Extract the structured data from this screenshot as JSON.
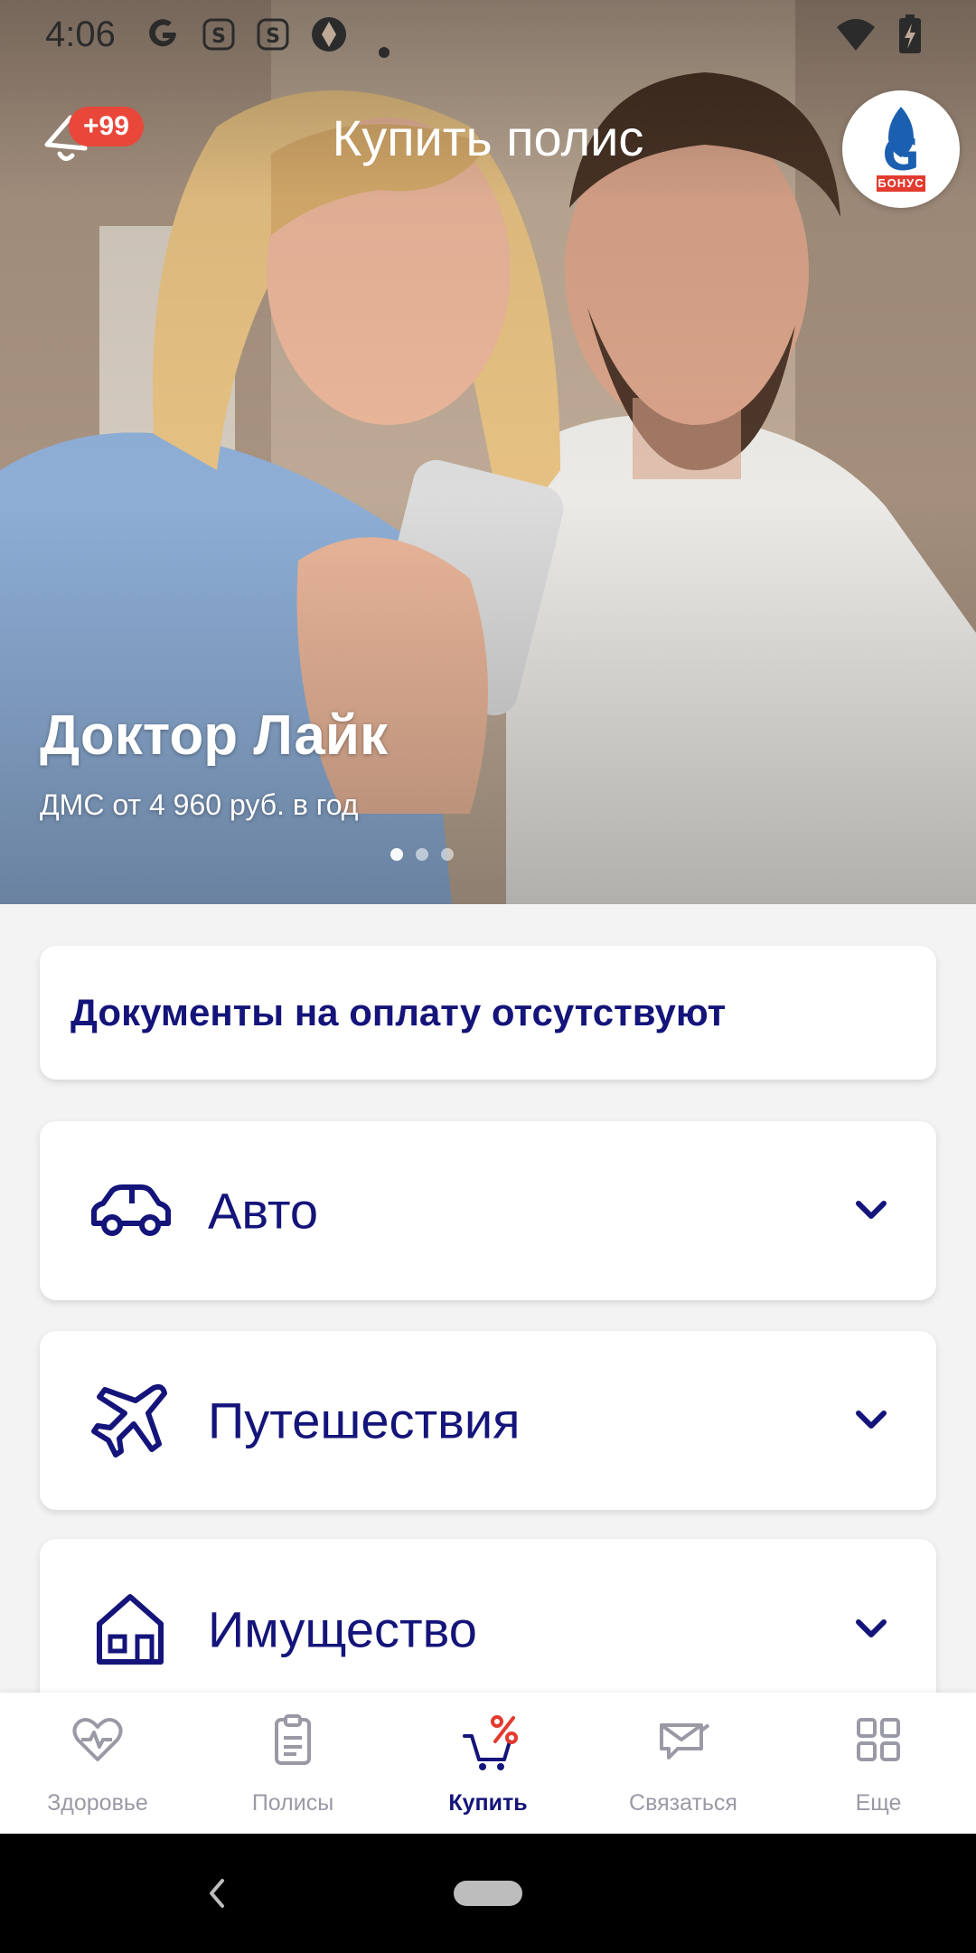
{
  "status_bar": {
    "time": "4:06",
    "left_icons": [
      "google-icon",
      "notification-s-icon",
      "notification-s-icon",
      "aperture-icon",
      "dot-icon"
    ],
    "right_icons": [
      "wifi-icon",
      "battery-charging-icon"
    ]
  },
  "header": {
    "title": "Купить полис",
    "notification_badge": "+99",
    "bonus_logo_text": "БОНУС"
  },
  "promo": {
    "title": "Доктор Лайк",
    "subtitle": "ДМС от 4 960 руб. в год",
    "slide_count": 3,
    "active_slide": 1
  },
  "notice": {
    "text": "Документы на оплату отсутствуют"
  },
  "categories": [
    {
      "label": "Авто",
      "icon": "car-icon"
    },
    {
      "label": "Путешествия",
      "icon": "airplane-icon"
    },
    {
      "label": "Имущество",
      "icon": "house-icon"
    }
  ],
  "bottom_nav": {
    "items": [
      {
        "label": "Здоровье",
        "icon": "heart-pulse-icon",
        "active": false
      },
      {
        "label": "Полисы",
        "icon": "clipboard-icon",
        "active": false
      },
      {
        "label": "Купить",
        "icon": "cart-percent-icon",
        "active": true
      },
      {
        "label": "Связаться",
        "icon": "chat-envelope-icon",
        "active": false
      },
      {
        "label": "Еще",
        "icon": "grid-icon",
        "active": false
      }
    ]
  },
  "colors": {
    "brand_navy": "#14147a",
    "badge_red": "#e8473a",
    "inactive_gray": "#9a9aa6",
    "background": "#f3f3f3"
  }
}
